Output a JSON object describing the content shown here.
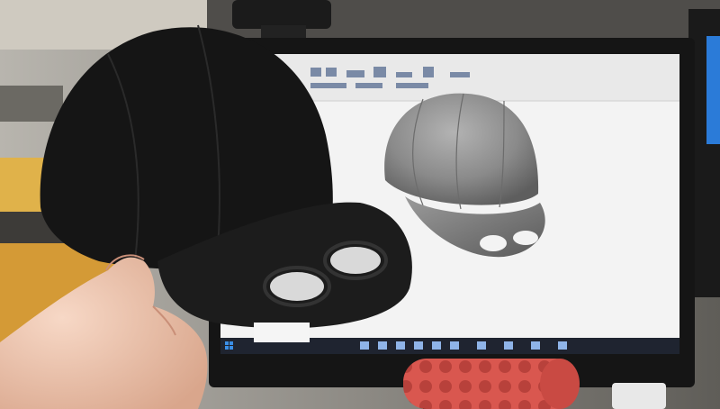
{
  "colors": {
    "wall": "#8d8a84",
    "wall_dark": "#5f5d58",
    "acoustic_panel": "#4f4d4a",
    "monitor_bezel": "#151515",
    "screen_bg": "#f3f3f3",
    "ribbon": "#e9e9e9",
    "cad_cap": "#8a8a8a",
    "printed_cap": "#151515",
    "hand": "#f0c9b4",
    "desk_shelf": "#e0b24a",
    "speaker": "#d9574f",
    "taskbar": "#1f2430"
  },
  "icons": {
    "webcam": "webcam-icon",
    "start": "windows-start-icon"
  }
}
